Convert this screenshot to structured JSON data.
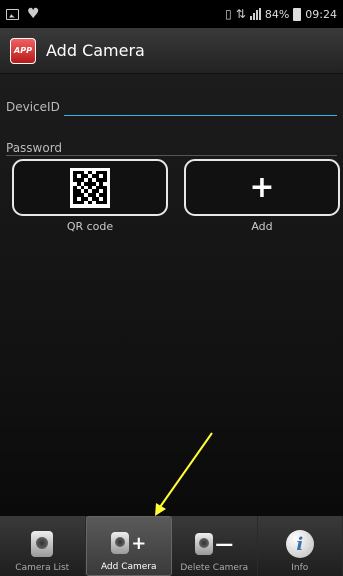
{
  "status_bar": {
    "battery": "84%",
    "time": "09:24"
  },
  "app": {
    "title": "Add Camera",
    "logo_text": "APP"
  },
  "form": {
    "device_id_label": "DeviceID",
    "device_id_value": "",
    "password_label": "Password",
    "password_value": ""
  },
  "buttons": {
    "qr_label": "QR code",
    "add_label": "Add"
  },
  "tabs": [
    {
      "label": "Camera List"
    },
    {
      "label": "Add Camera"
    },
    {
      "label": "Delete Camera"
    },
    {
      "label": "Info"
    }
  ],
  "colors": {
    "accent": "#33b5e5",
    "annotation_arrow": "#ffff33"
  }
}
